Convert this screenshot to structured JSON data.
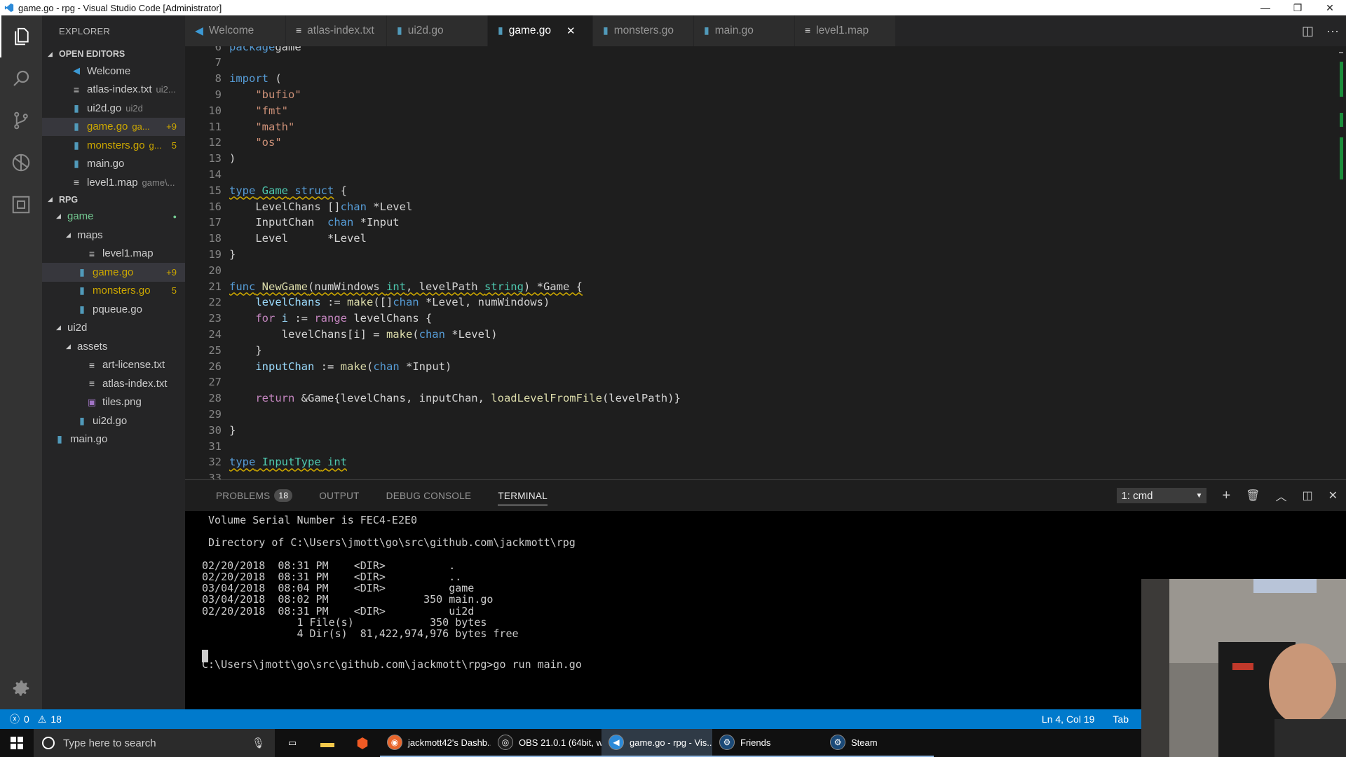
{
  "window": {
    "title": "game.go - rpg - Visual Studio Code [Administrator]",
    "minimize": "—",
    "restore": "❐",
    "close": "✕"
  },
  "activity_bar": {
    "items": [
      "files-icon",
      "search-icon",
      "source-control-icon",
      "debug-icon",
      "extensions-icon"
    ],
    "bottom": "gear-icon"
  },
  "sidebar": {
    "title": "EXPLORER",
    "open_editors_label": "OPEN EDITORS",
    "open_editors": [
      {
        "name": "Welcome",
        "desc": "",
        "badge": "",
        "icon": "vscode-icon",
        "state": ""
      },
      {
        "name": "atlas-index.txt",
        "desc": "ui2...",
        "badge": "",
        "icon": "text-file-icon",
        "state": ""
      },
      {
        "name": "ui2d.go",
        "desc": "ui2d",
        "badge": "",
        "icon": "go-file-icon",
        "state": ""
      },
      {
        "name": "game.go",
        "desc": "ga...",
        "badge": "+9",
        "icon": "go-file-icon",
        "state": "modified"
      },
      {
        "name": "monsters.go",
        "desc": "g...",
        "badge": "5",
        "icon": "go-file-icon",
        "state": "modified"
      },
      {
        "name": "main.go",
        "desc": "",
        "badge": "",
        "icon": "go-file-icon",
        "state": ""
      },
      {
        "name": "level1.map",
        "desc": "game\\...",
        "badge": "",
        "icon": "text-file-icon",
        "state": ""
      }
    ],
    "project_label": "RPG",
    "tree": [
      {
        "name": "game",
        "kind": "folder",
        "depth": 0,
        "badge": "●",
        "state": "untracked"
      },
      {
        "name": "maps",
        "kind": "folder",
        "depth": 1,
        "badge": "",
        "state": ""
      },
      {
        "name": "level1.map",
        "kind": "text",
        "depth": 2,
        "badge": "",
        "state": ""
      },
      {
        "name": "game.go",
        "kind": "go",
        "depth": 1,
        "badge": "+9",
        "state": "modified"
      },
      {
        "name": "monsters.go",
        "kind": "go",
        "depth": 1,
        "badge": "5",
        "state": "modified"
      },
      {
        "name": "pqueue.go",
        "kind": "go",
        "depth": 1,
        "badge": "",
        "state": ""
      },
      {
        "name": "ui2d",
        "kind": "folder",
        "depth": 0,
        "badge": "",
        "state": ""
      },
      {
        "name": "assets",
        "kind": "folder",
        "depth": 1,
        "badge": "",
        "state": ""
      },
      {
        "name": "art-license.txt",
        "kind": "text",
        "depth": 2,
        "badge": "",
        "state": ""
      },
      {
        "name": "atlas-index.txt",
        "kind": "text",
        "depth": 2,
        "badge": "",
        "state": ""
      },
      {
        "name": "tiles.png",
        "kind": "image",
        "depth": 2,
        "badge": "",
        "state": ""
      },
      {
        "name": "ui2d.go",
        "kind": "go",
        "depth": 1,
        "badge": "",
        "state": ""
      },
      {
        "name": "main.go",
        "kind": "go",
        "depth": -1,
        "badge": "",
        "state": ""
      }
    ]
  },
  "tabs": [
    {
      "label": "Welcome",
      "icon": "vscode-icon",
      "active": false
    },
    {
      "label": "atlas-index.txt",
      "icon": "text-file-icon",
      "active": false
    },
    {
      "label": "ui2d.go",
      "icon": "go-file-icon",
      "active": false
    },
    {
      "label": "game.go",
      "icon": "go-file-icon",
      "active": true,
      "close": "✕"
    },
    {
      "label": "monsters.go",
      "icon": "go-file-icon",
      "active": false
    },
    {
      "label": "main.go",
      "icon": "go-file-icon",
      "active": false
    },
    {
      "label": "level1.map",
      "icon": "text-file-icon",
      "active": false
    }
  ],
  "editor": {
    "lines": [
      {
        "n": "6",
        "tokens": [
          [
            "kw",
            "package"
          ],
          [
            "",
            "game"
          ]
        ]
      },
      {
        "n": "7",
        "tokens": []
      },
      {
        "n": "8",
        "tokens": [
          [
            "kw",
            "import"
          ],
          [
            "",
            " ("
          ]
        ]
      },
      {
        "n": "9",
        "tokens": [
          [
            "",
            "    "
          ],
          [
            "str",
            "\"bufio\""
          ]
        ]
      },
      {
        "n": "10",
        "tokens": [
          [
            "",
            "    "
          ],
          [
            "str",
            "\"fmt\""
          ]
        ]
      },
      {
        "n": "11",
        "tokens": [
          [
            "",
            "    "
          ],
          [
            "str",
            "\"math\""
          ]
        ]
      },
      {
        "n": "12",
        "tokens": [
          [
            "",
            "    "
          ],
          [
            "str",
            "\"os\""
          ]
        ]
      },
      {
        "n": "13",
        "tokens": [
          [
            "",
            ")"
          ]
        ]
      },
      {
        "n": "14",
        "tokens": []
      },
      {
        "n": "15",
        "tokens": [
          [
            "kw warn",
            "type"
          ],
          [
            "warn",
            " "
          ],
          [
            "ty warn",
            "Game"
          ],
          [
            "warn",
            " "
          ],
          [
            "kw warn",
            "struct"
          ],
          [
            "",
            " {"
          ]
        ]
      },
      {
        "n": "16",
        "tokens": [
          [
            "",
            "    LevelChans []"
          ],
          [
            "kw",
            "chan"
          ],
          [
            "",
            " *Level"
          ]
        ]
      },
      {
        "n": "17",
        "tokens": [
          [
            "",
            "    InputChan  "
          ],
          [
            "kw",
            "chan"
          ],
          [
            "",
            " *Input"
          ]
        ]
      },
      {
        "n": "18",
        "tokens": [
          [
            "",
            "    Level      *Level"
          ]
        ]
      },
      {
        "n": "19",
        "tokens": [
          [
            "",
            "}"
          ]
        ]
      },
      {
        "n": "20",
        "tokens": []
      },
      {
        "n": "21",
        "tokens": [
          [
            "kw warn",
            "func"
          ],
          [
            "warn",
            " "
          ],
          [
            "fn warn",
            "NewGame"
          ],
          [
            "warn",
            "(numWindows "
          ],
          [
            "ty warn",
            "int"
          ],
          [
            "warn",
            ", levelPath "
          ],
          [
            "ty warn",
            "string"
          ],
          [
            "warn",
            ") *Game {"
          ]
        ]
      },
      {
        "n": "22",
        "tokens": [
          [
            "",
            "    "
          ],
          [
            "var",
            "levelChans"
          ],
          [
            "",
            " := "
          ],
          [
            "fn",
            "make"
          ],
          [
            "",
            "([]"
          ],
          [
            "kw",
            "chan"
          ],
          [
            "",
            " *Level, numWindows)"
          ]
        ]
      },
      {
        "n": "23",
        "tokens": [
          [
            "",
            "    "
          ],
          [
            "ctl",
            "for"
          ],
          [
            "",
            " "
          ],
          [
            "var",
            "i"
          ],
          [
            "",
            " := "
          ],
          [
            "ctl",
            "range"
          ],
          [
            "",
            " levelChans {"
          ]
        ]
      },
      {
        "n": "24",
        "tokens": [
          [
            "",
            "        levelChans[i] = "
          ],
          [
            "fn",
            "make"
          ],
          [
            "",
            "("
          ],
          [
            "kw",
            "chan"
          ],
          [
            "",
            " *Level)"
          ]
        ]
      },
      {
        "n": "25",
        "tokens": [
          [
            "",
            "    }"
          ]
        ]
      },
      {
        "n": "26",
        "tokens": [
          [
            "",
            "    "
          ],
          [
            "var",
            "inputChan"
          ],
          [
            "",
            " := "
          ],
          [
            "fn",
            "make"
          ],
          [
            "",
            "("
          ],
          [
            "kw",
            "chan"
          ],
          [
            "",
            " *Input)"
          ]
        ]
      },
      {
        "n": "27",
        "tokens": []
      },
      {
        "n": "28",
        "tokens": [
          [
            "",
            "    "
          ],
          [
            "ctl",
            "return"
          ],
          [
            "",
            " &Game{levelChans, inputChan, "
          ],
          [
            "fn",
            "loadLevelFromFile"
          ],
          [
            "",
            "(levelPath)}"
          ]
        ]
      },
      {
        "n": "29",
        "tokens": []
      },
      {
        "n": "30",
        "tokens": [
          [
            "",
            "}"
          ]
        ]
      },
      {
        "n": "31",
        "tokens": []
      },
      {
        "n": "32",
        "tokens": [
          [
            "kw warn",
            "type"
          ],
          [
            "warn",
            " "
          ],
          [
            "ty warn",
            "InputType"
          ],
          [
            "warn",
            " "
          ],
          [
            "ty warn",
            "int"
          ]
        ]
      },
      {
        "n": "33",
        "tokens": []
      }
    ]
  },
  "panel": {
    "tabs": [
      "PROBLEMS",
      "OUTPUT",
      "DEBUG CONSOLE",
      "TERMINAL"
    ],
    "problems_count": "18",
    "terminal_select": "1: cmd",
    "terminal_lines": [
      " Volume Serial Number is FEC4-E2E0",
      "",
      " Directory of C:\\Users\\jmott\\go\\src\\github.com\\jackmott\\rpg",
      "",
      "02/20/2018  08:31 PM    <DIR>          .",
      "02/20/2018  08:31 PM    <DIR>          ..",
      "03/04/2018  08:04 PM    <DIR>          game",
      "03/04/2018  08:02 PM               350 main.go",
      "02/20/2018  08:31 PM    <DIR>          ui2d",
      "               1 File(s)            350 bytes",
      "               4 Dir(s)  81,422,974,976 bytes free",
      "",
      "C:\\Users\\jmott\\go\\src\\github.com\\jackmott\\rpg>go run main.go"
    ]
  },
  "statusbar": {
    "errors": "0",
    "warnings": "18",
    "position": "Ln 4, Col 19",
    "indent": "Tab"
  },
  "taskbar": {
    "search_placeholder": "Type here to search",
    "apps": [
      {
        "label": "jackmott42's Dashb...",
        "icon": "firefox-icon",
        "active": false
      },
      {
        "label": "OBS 21.0.1 (64bit, w...",
        "icon": "obs-icon",
        "active": false
      },
      {
        "label": "game.go - rpg - Vis...",
        "icon": "vscode-icon",
        "active": true
      },
      {
        "label": "Friends",
        "icon": "steam-icon",
        "active": false
      },
      {
        "label": "Steam",
        "icon": "steam-icon",
        "active": false
      }
    ]
  },
  "colors": {
    "accent": "#007acc",
    "modified": "#cca700",
    "untracked": "#73c991"
  }
}
